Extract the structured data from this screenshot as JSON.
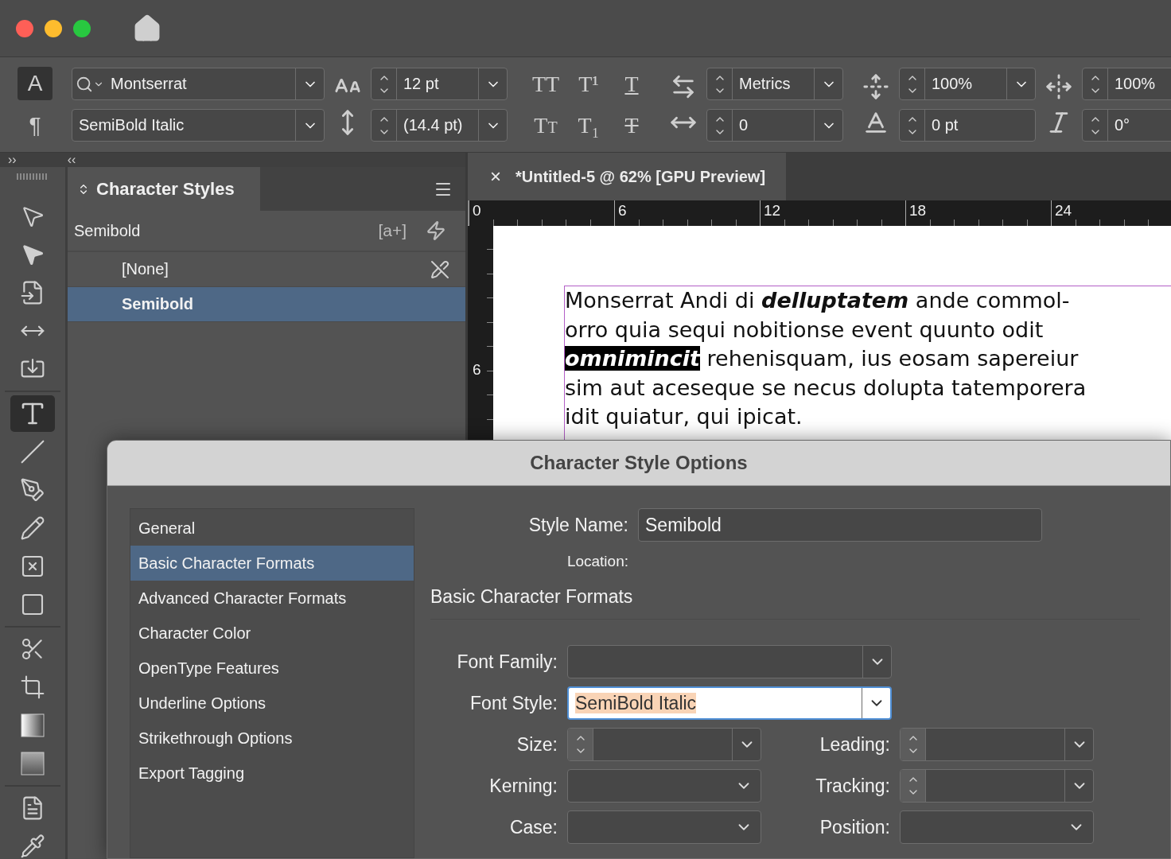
{
  "control_bar": {
    "modes": [
      {
        "glyph": "A",
        "selected": true
      },
      {
        "glyph": "¶",
        "selected": false
      }
    ],
    "font_family": "Montserrat",
    "font_style": "SemiBold Italic",
    "font_size": "12 pt",
    "leading": "(14.4 pt)",
    "type_styles": [
      {
        "kind": "all-caps",
        "glyph": "TT"
      },
      {
        "kind": "superscript",
        "glyph": "T¹"
      },
      {
        "kind": "underline",
        "glyph": "T"
      },
      {
        "kind": "small-caps",
        "glyph": "Tt"
      },
      {
        "kind": "subscript",
        "glyph": "T₁"
      },
      {
        "kind": "strikethrough",
        "glyph": "T"
      }
    ],
    "kerning": "Metrics",
    "tracking": "0",
    "vertical_scale": "100%",
    "baseline_shift": "0 pt",
    "horizontal_scale": "100%",
    "skew": "0°"
  },
  "panel_bar": {
    "expand_glyph": "››",
    "collapse_glyph": "‹‹"
  },
  "tool_groups": [
    [
      {
        "kind": "selection",
        "selected": false
      },
      {
        "kind": "direct-selection",
        "selected": false
      },
      {
        "kind": "page",
        "selected": false
      },
      {
        "kind": "gap",
        "selected": false
      },
      {
        "kind": "content-collector",
        "selected": false
      }
    ],
    [
      {
        "kind": "type",
        "selected": true
      },
      {
        "kind": "line",
        "selected": false
      },
      {
        "kind": "pen",
        "selected": false
      },
      {
        "kind": "pencil",
        "selected": false
      },
      {
        "kind": "rectangle-frame",
        "selected": false
      },
      {
        "kind": "rectangle",
        "selected": false
      }
    ],
    [
      {
        "kind": "scissors",
        "selected": false
      },
      {
        "kind": "free-transform",
        "selected": false
      },
      {
        "kind": "gradient",
        "selected": false
      },
      {
        "kind": "gradient-feather",
        "selected": false
      }
    ],
    [
      {
        "kind": "note",
        "selected": false
      },
      {
        "kind": "eyedropper",
        "selected": false
      }
    ]
  ],
  "character_styles": {
    "title": "Character Styles",
    "current": "Semibold",
    "new_style_glyph": "[a+]",
    "items": [
      {
        "name": "[None]",
        "selected": false,
        "locked": true
      },
      {
        "name": "Semibold",
        "selected": true,
        "locked": false
      }
    ]
  },
  "document": {
    "tab": {
      "close_glyph": "×",
      "title": "*Untitled-5 @ 62% [GPU Preview]"
    },
    "ruler_h": [
      "0",
      "6",
      "12",
      "18",
      "24"
    ],
    "ruler_v": [
      "6"
    ],
    "lines": [
      [
        {
          "text": "Monserrat Andi di ",
          "kind": "plain"
        },
        {
          "text": "delluptatem",
          "kind": "emphasis"
        },
        {
          "text": " ande commol-",
          "kind": "plain"
        }
      ],
      [
        {
          "text": "orro quia sequi nobitionse event quunto odit",
          "kind": "plain"
        }
      ],
      [
        {
          "text": "omnimincit",
          "kind": "highlighted"
        },
        {
          "text": " rehenisquam, ius eosam sapereiur",
          "kind": "plain"
        }
      ],
      [
        {
          "text": "sim aut aceseque se necus dolupta tatemporera",
          "kind": "plain"
        }
      ],
      [
        {
          "text": "idit quiatur, qui ipicat.",
          "kind": "plain"
        }
      ]
    ]
  },
  "dialog": {
    "title": "Character Style Options",
    "sections": [
      {
        "label": "General",
        "selected": false
      },
      {
        "label": "Basic Character Formats",
        "selected": true
      },
      {
        "label": "Advanced Character Formats",
        "selected": false
      },
      {
        "label": "Character Color",
        "selected": false
      },
      {
        "label": "OpenType Features",
        "selected": false
      },
      {
        "label": "Underline Options",
        "selected": false
      },
      {
        "label": "Strikethrough Options",
        "selected": false
      },
      {
        "label": "Export Tagging",
        "selected": false
      }
    ],
    "style_name_label": "Style Name:",
    "style_name": "Semibold",
    "location_label": "Location:",
    "heading": "Basic Character Formats",
    "fields": [
      {
        "label": "Font Family:",
        "kind": "wide-dropdown",
        "focused": false
      },
      {
        "label": "Font Style:",
        "kind": "wide-dropdown",
        "value": "SemiBold Italic",
        "focused": true
      },
      {
        "label": "Size:",
        "kind": "spinner",
        "focused": false
      },
      {
        "label": "Leading:",
        "kind": "spinner",
        "focused": false
      },
      {
        "label": "Kerning:",
        "kind": "dropdown",
        "focused": false
      },
      {
        "label": "Tracking:",
        "kind": "spinner",
        "focused": false
      },
      {
        "label": "Case:",
        "kind": "dropdown",
        "focused": false
      },
      {
        "label": "Position:",
        "kind": "dropdown",
        "focused": false
      }
    ]
  }
}
